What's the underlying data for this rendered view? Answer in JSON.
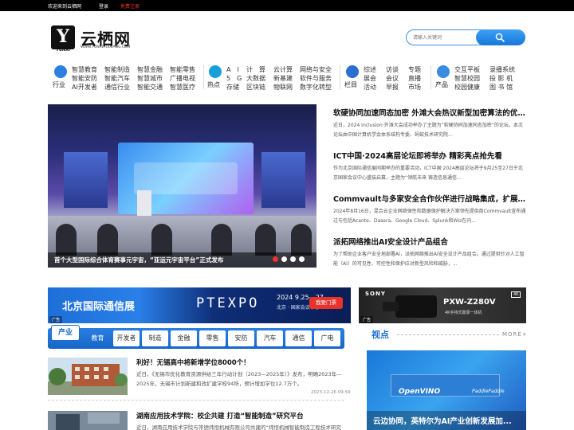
{
  "topbar": {
    "welcome": "欢迎来到云栖网",
    "login": "登录",
    "register": "免费注册"
  },
  "header": {
    "logo_mark_text": "YUNXI",
    "site_name": "云栖网",
    "site_url": "WWW.YUNXIHUIXIANG.COM",
    "search_placeholder": "请输入关键词"
  },
  "nav": {
    "groups": [
      {
        "label": "行业",
        "icon": "industry-icon",
        "color": "#2a7fe0",
        "items": [
          "智慧教育",
          "智能制造",
          "智慧金融",
          "智能零售",
          "智能安防",
          "智能汽车",
          "智慧城市",
          "广播电视",
          "AI开发者",
          "通信行业",
          "智能交通",
          "智慧医疗"
        ]
      },
      {
        "label": "热点",
        "icon": "hotspot-icon",
        "color": "#1aa0d8",
        "items": [
          "A　I",
          "计　算",
          "云计算",
          "网络与安全",
          "5　G",
          "大数据",
          "新基建",
          "软件与服务",
          "存储",
          "区块链",
          "物联网",
          "数字化转型"
        ]
      },
      {
        "label": "栏目",
        "icon": "column-icon",
        "color": "#2a6fd0",
        "items": [
          "综述",
          "访谈",
          "专题",
          "展会",
          "会议",
          "直播",
          "活动",
          "早报",
          "市场"
        ]
      },
      {
        "label": "产品",
        "icon": "product-icon",
        "color": "#3a8ae0",
        "items": [
          "交互平板",
          "录播系统",
          "智慧校园",
          "投 影 机",
          "校园健康",
          "图 书 馆"
        ]
      }
    ]
  },
  "slider": {
    "caption": "首个大型国际综合体育赛事元宇宙，“亚运元宇宙平台”正式发布",
    "dots": [
      true,
      false,
      false,
      false
    ]
  },
  "headlines": [
    {
      "title": "软硬协同加速同态加密 外滩大会热议新型加密算法的优化...",
      "desc": "近日，2024 Inclusion·外滩大会成功举办了主题为“软硬协同加速同态加密”的论坛。本次论坛由中国计算机学会体系结构专委、蚂蚁技术研究院..."
    },
    {
      "title": "ICT中国·2024高层论坛即将举办 精彩亮点抢先看",
      "desc": "作为北京国际通信展同期举办的重要活动，ICT中国·2024高层论坛将于9月25至27日于北京国家会议中心盛装启幕，主题为“领航未来 铸造信息通信..."
    },
    {
      "title": "Commvault与多家安全合作伙伴进行战略集成，扩展网络...",
      "desc": "2024年8月16日，混合云企业网络弹性和数据保护解决方案领先提供商Commvault宣布通过与包括Acante、Dasera、Google Cloud、Splunk和Wiz在内..."
    },
    {
      "title": "派拓网络推出AI安全设计产品组合",
      "desc": "为了帮助企业客户安全地部署AI，派拓网络推出AI安全设计产品组合。通过提供针对人工智能（AI）的可见性、可控性和保护应对新型风险和威胁，..."
    }
  ],
  "banner": {
    "title": "北京国际通信展",
    "logo": "PTEXPO",
    "date": "2024  9.25—27",
    "location": "北京 · 国家会议中心",
    "button": "我要门票",
    "ad_tag": "广告"
  },
  "sony_ad": {
    "brand": "SONY",
    "model": "PXW-Z280V",
    "desc": "4K手持式摄录一体机",
    "badge": "4K",
    "ad_tag": "广告"
  },
  "industry_tabs": {
    "main": "产业",
    "tabs": [
      "教育",
      "开发者",
      "制造",
      "金融",
      "零售",
      "安防",
      "汽车",
      "通信",
      "广电"
    ]
  },
  "viewpoint": {
    "heading": "视点",
    "more": "MORE+",
    "brand_a": "OpenVINO",
    "brand_b": "PaddlePaddle",
    "caption": "云边协同，英特尔为AI产业创新发展加..."
  },
  "news": [
    {
      "title": "利好！无锡高中将新增学位8000个！",
      "desc": "近日，《无锡市优化教育资源供给三年行动计划（2023—2025年）》发布，明确2023年—2025年，无锡市计划新建和改扩建学校94所，预计增加学位12.7万个。",
      "date": "2023-12-26 09:59"
    },
    {
      "title": "湖南应用技术学院：校企共建 打造“智能制造”研究平台",
      "desc": "近日，湖南应用技术学院与常德纬恒机械有限公司共建的“纬恒机械智能制造工程技术研究中心”正式揭牌。",
      "date": ""
    }
  ]
}
